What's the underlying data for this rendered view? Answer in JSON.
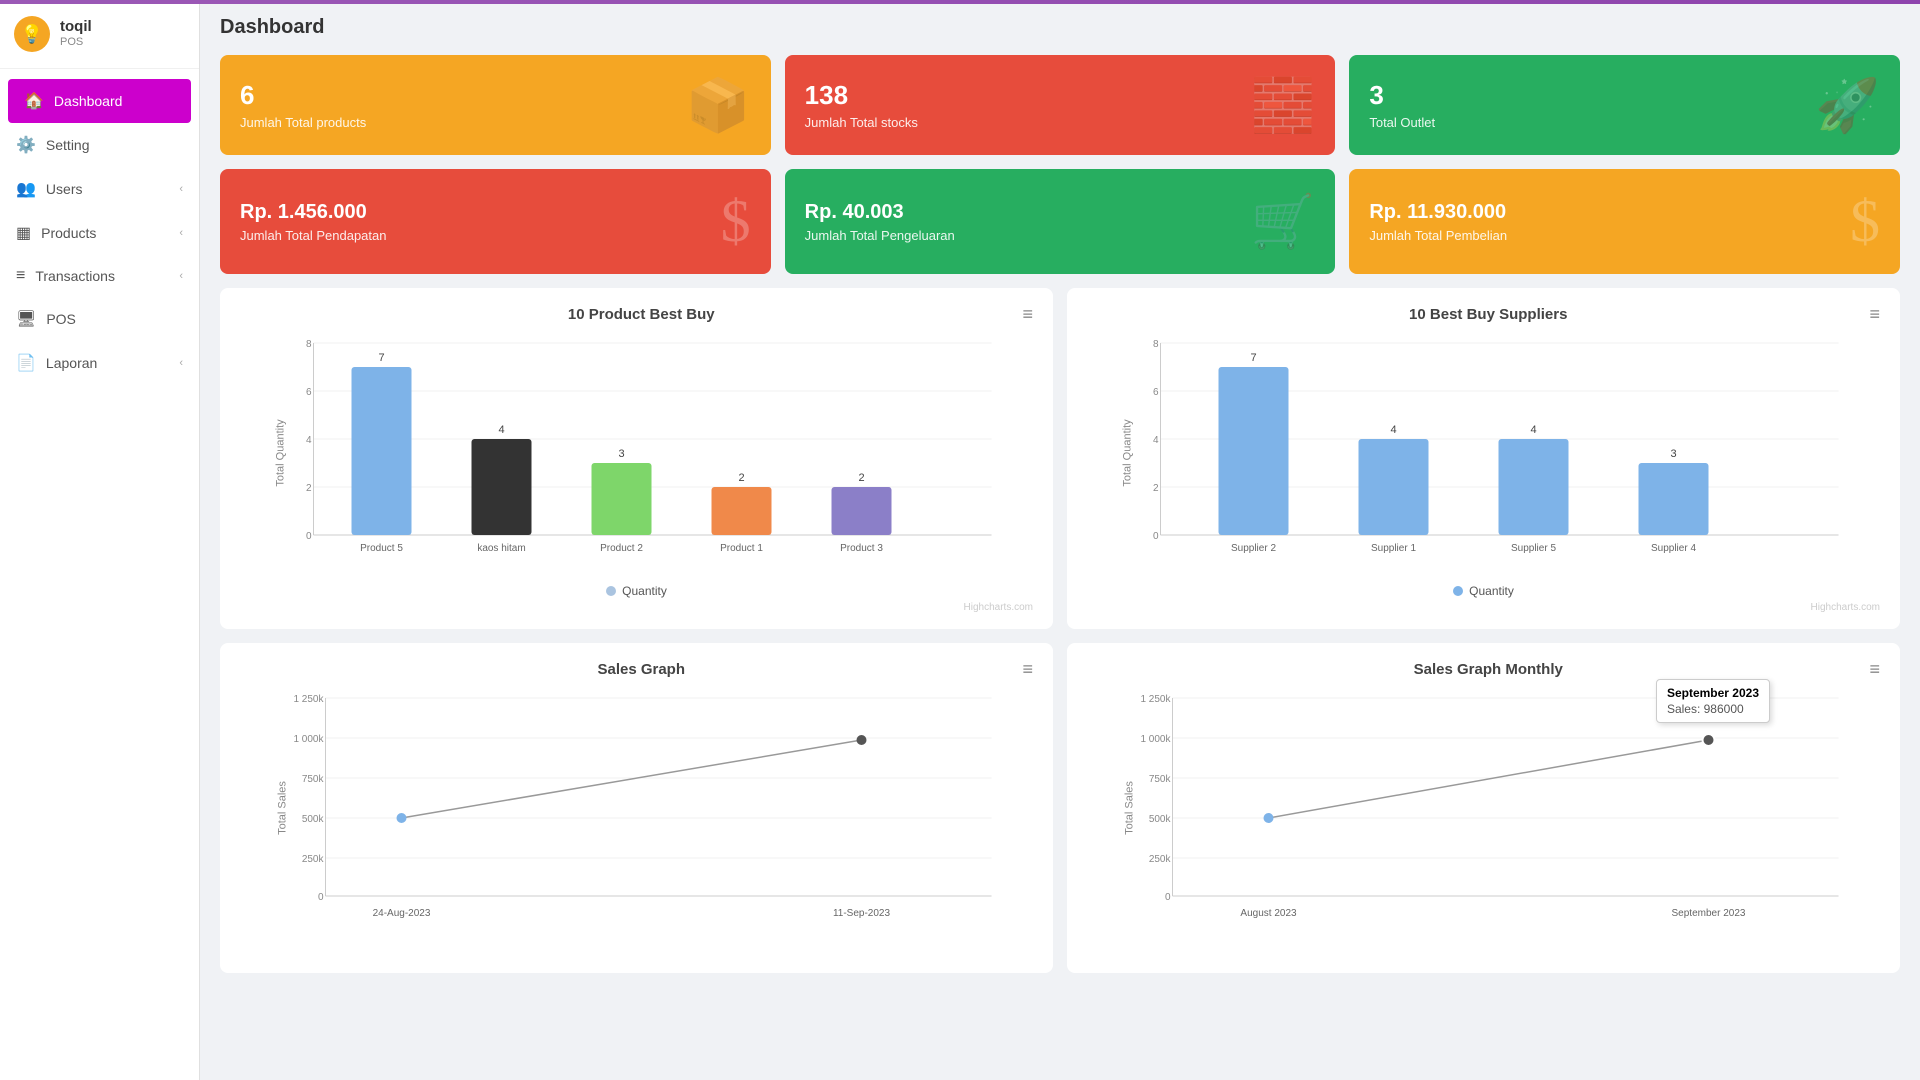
{
  "app": {
    "name": "toqil",
    "module": "POS"
  },
  "sidebar": {
    "items": [
      {
        "id": "dashboard",
        "label": "Dashboard",
        "icon": "🏠",
        "active": true,
        "hasChevron": false
      },
      {
        "id": "setting",
        "label": "Setting",
        "icon": "⚙️",
        "active": false,
        "hasChevron": false
      },
      {
        "id": "users",
        "label": "Users",
        "icon": "👥",
        "active": false,
        "hasChevron": true
      },
      {
        "id": "products",
        "label": "Products",
        "icon": "▦",
        "active": false,
        "hasChevron": true
      },
      {
        "id": "transactions",
        "label": "Transactions",
        "icon": "≡",
        "active": false,
        "hasChevron": true
      },
      {
        "id": "pos",
        "label": "POS",
        "icon": "🖥",
        "active": false,
        "hasChevron": false
      },
      {
        "id": "laporan",
        "label": "Laporan",
        "icon": "📄",
        "active": false,
        "hasChevron": true
      }
    ]
  },
  "page": {
    "title": "Dashboard"
  },
  "cards": {
    "row1": [
      {
        "id": "total-products",
        "value": "6",
        "label": "Jumlah Total products",
        "color": "card-orange",
        "icon": "📦"
      },
      {
        "id": "total-stocks",
        "value": "138",
        "label": "Jumlah Total stocks",
        "color": "card-red",
        "icon": "🧱"
      },
      {
        "id": "total-outlet",
        "value": "3",
        "label": "Total Outlet",
        "color": "card-green",
        "icon": "🚀"
      }
    ],
    "row2": [
      {
        "id": "total-pendapatan",
        "value": "Rp. 1.456.000",
        "label": "Jumlah Total Pendapatan",
        "color": "card-red",
        "icon": "$"
      },
      {
        "id": "total-pengeluaran",
        "value": "Rp. 40.003",
        "label": "Jumlah Total Pengeluaran",
        "color": "card-green",
        "icon": "🛒"
      },
      {
        "id": "total-pembelian",
        "value": "Rp. 11.930.000",
        "label": "Jumlah Total Pembelian",
        "color": "card-orange",
        "icon": "$"
      }
    ]
  },
  "chart_best_buy": {
    "title": "10 Product Best Buy",
    "menu_icon": "≡",
    "bars": [
      {
        "label": "Product 5",
        "value": 7,
        "color": "#7eb3e8"
      },
      {
        "label": "kaos hitam",
        "value": 4,
        "color": "#333"
      },
      {
        "label": "Product 2",
        "value": 3,
        "color": "#7ed66a"
      },
      {
        "label": "Product 1",
        "value": 2,
        "color": "#f0894a"
      },
      {
        "label": "Product 3",
        "value": 2,
        "color": "#8b7fc8"
      }
    ],
    "y_max": 8,
    "y_ticks": [
      "8",
      "6",
      "4",
      "2",
      "0"
    ],
    "y_title": "Total Quantity",
    "legend_label": "Quantity",
    "legend_color": "#aac4e0",
    "credit": "Highcharts.com"
  },
  "chart_best_suppliers": {
    "title": "10 Best Buy Suppliers",
    "menu_icon": "≡",
    "bars": [
      {
        "label": "Supplier 2",
        "value": 7,
        "color": "#7eb3e8"
      },
      {
        "label": "Supplier 1",
        "value": 4,
        "color": "#7eb3e8"
      },
      {
        "label": "Supplier 5",
        "value": 4,
        "color": "#7eb3e8"
      },
      {
        "label": "Supplier 4",
        "value": 3,
        "color": "#7eb3e8"
      }
    ],
    "y_max": 8,
    "y_ticks": [
      "8",
      "6",
      "4",
      "2",
      "0"
    ],
    "y_title": "Total Quantity",
    "legend_label": "Quantity",
    "legend_color": "#7eb3e8",
    "credit": "Highcharts.com"
  },
  "chart_sales": {
    "title": "Sales Graph",
    "menu_icon": "≡",
    "x_labels": [
      "24-Aug-2023",
      "11-Sep-2023"
    ],
    "y_labels": [
      "1 250k",
      "1 000k",
      "750k",
      "500k",
      "250k",
      "0"
    ],
    "y_title": "Total Sales",
    "points": [
      {
        "x": 0.15,
        "y": 0.42,
        "label": "500k"
      },
      {
        "x": 0.75,
        "y": 0.12,
        "label": "1 000k"
      }
    ]
  },
  "chart_sales_monthly": {
    "title": "Sales Graph Monthly",
    "menu_icon": "≡",
    "x_labels": [
      "August 2023",
      "September 2023"
    ],
    "y_labels": [
      "1 250k",
      "1 000k",
      "750k",
      "500k",
      "250k",
      "0"
    ],
    "y_title": "Total Sales",
    "tooltip": {
      "title": "September 2023",
      "value_label": "Sales: 986000"
    },
    "points": [
      {
        "x": 0.2,
        "y": 0.42
      },
      {
        "x": 0.8,
        "y": 0.12
      }
    ]
  }
}
